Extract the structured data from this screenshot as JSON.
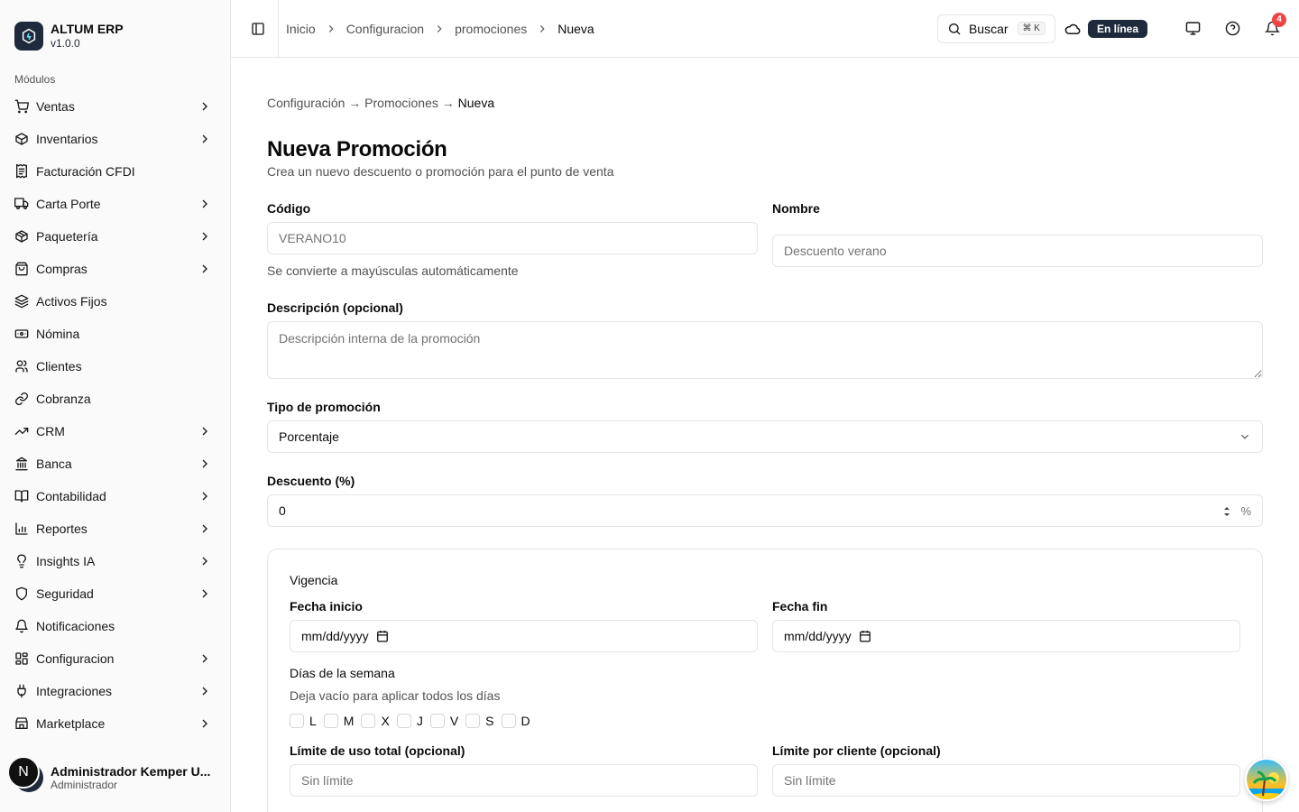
{
  "brand": {
    "name": "ALTUM ERP",
    "version": "v1.0.0"
  },
  "sidebar": {
    "group_label": "Módulos",
    "items": [
      {
        "label": "Ventas",
        "icon": "cart-icon",
        "chevron": true
      },
      {
        "label": "Inventarios",
        "icon": "package-icon",
        "chevron": true
      },
      {
        "label": "Facturación CFDI",
        "icon": "receipt-icon",
        "chevron": false
      },
      {
        "label": "Carta Porte",
        "icon": "truck-icon",
        "chevron": true
      },
      {
        "label": "Paquetería",
        "icon": "box-icon",
        "chevron": true
      },
      {
        "label": "Compras",
        "icon": "shopping-bag-icon",
        "chevron": true
      },
      {
        "label": "Activos Fijos",
        "icon": "layers-icon",
        "chevron": false
      },
      {
        "label": "Nómina",
        "icon": "banknote-icon",
        "chevron": false
      },
      {
        "label": "Clientes",
        "icon": "users-icon",
        "chevron": false
      },
      {
        "label": "Cobranza",
        "icon": "link-icon",
        "chevron": false
      },
      {
        "label": "CRM",
        "icon": "trending-up-icon",
        "chevron": true
      },
      {
        "label": "Banca",
        "icon": "bank-icon",
        "chevron": true
      },
      {
        "label": "Contabilidad",
        "icon": "book-icon",
        "chevron": true
      },
      {
        "label": "Reportes",
        "icon": "bar-chart-icon",
        "chevron": true
      },
      {
        "label": "Insights IA",
        "icon": "lightbulb-icon",
        "chevron": true
      },
      {
        "label": "Seguridad",
        "icon": "shield-icon",
        "chevron": true
      },
      {
        "label": "Notificaciones",
        "icon": "bell-icon",
        "chevron": false
      },
      {
        "label": "Configuracion",
        "icon": "settings-icon",
        "chevron": true
      },
      {
        "label": "Integraciones",
        "icon": "plug-icon",
        "chevron": true
      },
      {
        "label": "Marketplace",
        "icon": "store-icon",
        "chevron": true
      }
    ]
  },
  "user": {
    "name": "Administrador Kemper U...",
    "role": "Administrador",
    "initial": "N"
  },
  "topbar": {
    "breadcrumbs": [
      "Inicio",
      "Configuracion",
      "promociones",
      "Nueva"
    ],
    "search_label": "Buscar",
    "search_kbd": "⌘ K",
    "status": "En línea",
    "notifications": "4"
  },
  "page": {
    "breadcrumb": {
      "parts": [
        "Configuración",
        "Promociones"
      ],
      "arrow": "→",
      "current": "Nueva"
    },
    "title": "Nueva Promoción",
    "subtitle": "Crea un nuevo descuento o promoción para el punto de venta"
  },
  "form": {
    "codigo": {
      "label": "Código",
      "placeholder": "VERANO10",
      "hint": "Se convierte a mayúsculas automáticamente"
    },
    "nombre": {
      "label": "Nombre",
      "placeholder": "Descuento verano"
    },
    "descripcion": {
      "label": "Descripción (opcional)",
      "placeholder": "Descripción interna de la promoción"
    },
    "tipo": {
      "label": "Tipo de promoción",
      "value": "Porcentaje"
    },
    "descuento": {
      "label": "Descuento (%)",
      "value": "0",
      "suffix": "%"
    }
  },
  "vigencia": {
    "title": "Vigencia",
    "fecha_inicio": {
      "label": "Fecha inicio",
      "value": "mm/dd/yyyy"
    },
    "fecha_fin": {
      "label": "Fecha fin",
      "value": "mm/dd/yyyy"
    },
    "dias": {
      "label": "Días de la semana",
      "hint": "Deja vacío para aplicar todos los días",
      "items": [
        "L",
        "M",
        "X",
        "J",
        "V",
        "S",
        "D"
      ]
    },
    "limite_total": {
      "label": "Límite de uso total (opcional)",
      "placeholder": "Sin límite"
    },
    "limite_cliente": {
      "label": "Límite por cliente (opcional)",
      "placeholder": "Sin límite"
    }
  }
}
